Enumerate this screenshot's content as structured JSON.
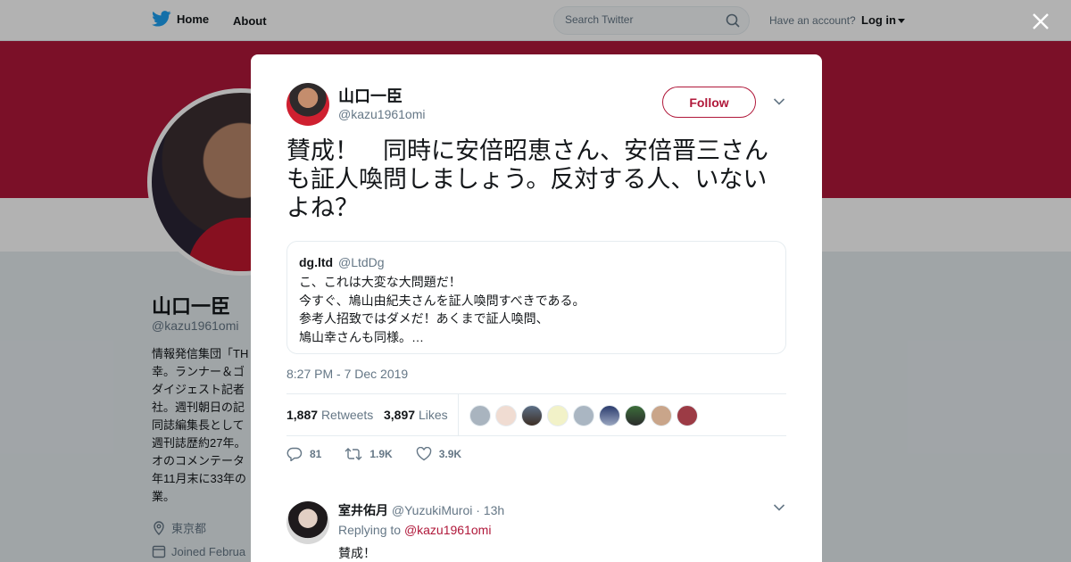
{
  "topbar": {
    "home_label": "Home",
    "about_label": "About",
    "search_placeholder": "Search Twitter",
    "have_account": "Have an account?",
    "login_label": "Log in"
  },
  "profile": {
    "name": "山口一臣",
    "handle": "@kazu1961omi",
    "bio_lines": [
      "情報発信集団「TH",
      "幸。ランナー＆ゴ",
      "ダイジェスト記者",
      "社。週刊朝日の記",
      "同誌編集長として",
      "週刊誌歴約27年。",
      "オのコメンテータ",
      "年11月末に33年の",
      "業。"
    ],
    "location": "東京都",
    "joined": "Joined Februa"
  },
  "tweet": {
    "author_name": "山口一臣",
    "author_handle": "@kazu1961omi",
    "follow_label": "Follow",
    "text_lines": [
      "賛成！　同時に安倍昭恵さん、安倍晋三さん",
      "も証人喚問しましょう。反対する人、いない",
      "よね？"
    ],
    "quoted": {
      "name": "dg.ltd",
      "handle": "@LtdDg",
      "lines": [
        "こ、これは大変な大問題だ！",
        "今すぐ、鳩山由紀夫さんを証人喚問すべきである。",
        "参考人招致ではダメだ！あくまで証人喚問、",
        "鳩山幸さんも同様。…"
      ]
    },
    "timestamp": "8:27 PM - 7 Dec 2019",
    "retweets_count": "1,887",
    "retweets_label": "Retweets",
    "likes_count": "3,897",
    "likes_label": "Likes",
    "actions": {
      "replies": "81",
      "retweets": "1.9K",
      "likes": "3.9K"
    }
  },
  "reply": {
    "name": "室井佑月",
    "handle": "@YuzukiMuroi",
    "time": "· 13h",
    "replying_to_label": "Replying to",
    "replying_to_handle": "@kazu1961omi",
    "text": "賛成！"
  },
  "colors": {
    "brand": "#b0183a",
    "twitter_blue": "#1da1f2",
    "muted": "#657786"
  },
  "icons": [
    "twitter-bird-icon",
    "search-icon",
    "close-icon",
    "chevron-down-icon",
    "reply-icon",
    "retweet-icon",
    "heart-icon",
    "location-icon",
    "calendar-icon"
  ]
}
